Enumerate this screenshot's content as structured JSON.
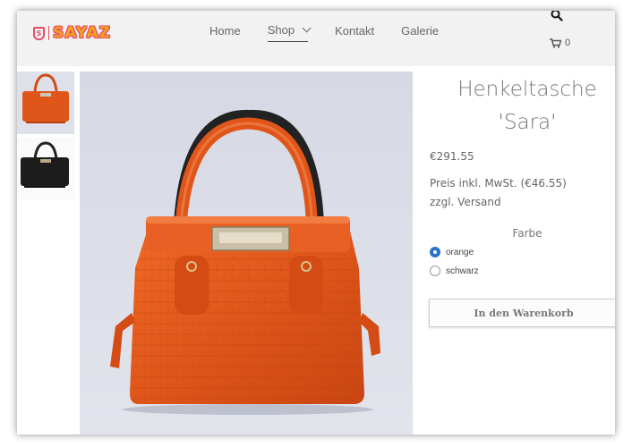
{
  "header": {
    "logo_text": "SAYAZ",
    "logo_badge": "S",
    "nav": [
      {
        "label": "Home"
      },
      {
        "label": "Shop"
      },
      {
        "label": "Kontakt"
      },
      {
        "label": "Galerie"
      }
    ],
    "cart_count": "0"
  },
  "product": {
    "title_line1": "Henkeltasche",
    "title_line2": "'Sara'",
    "price": "€291.55",
    "tax_line": "Preis inkl. MwSt. (€46.55)",
    "shipping_line": "zzgl. Versand",
    "color_label": "Farbe",
    "color_options": [
      {
        "label": "orange",
        "selected": true
      },
      {
        "label": "schwarz",
        "selected": false
      }
    ],
    "add_to_cart_label": "In den Warenkorb"
  },
  "colors": {
    "bag_orange": "#e0561a",
    "bag_black": "#1c1c1c",
    "radio_selected": "#2a73c8",
    "header_bg": "#f2f2f2"
  }
}
